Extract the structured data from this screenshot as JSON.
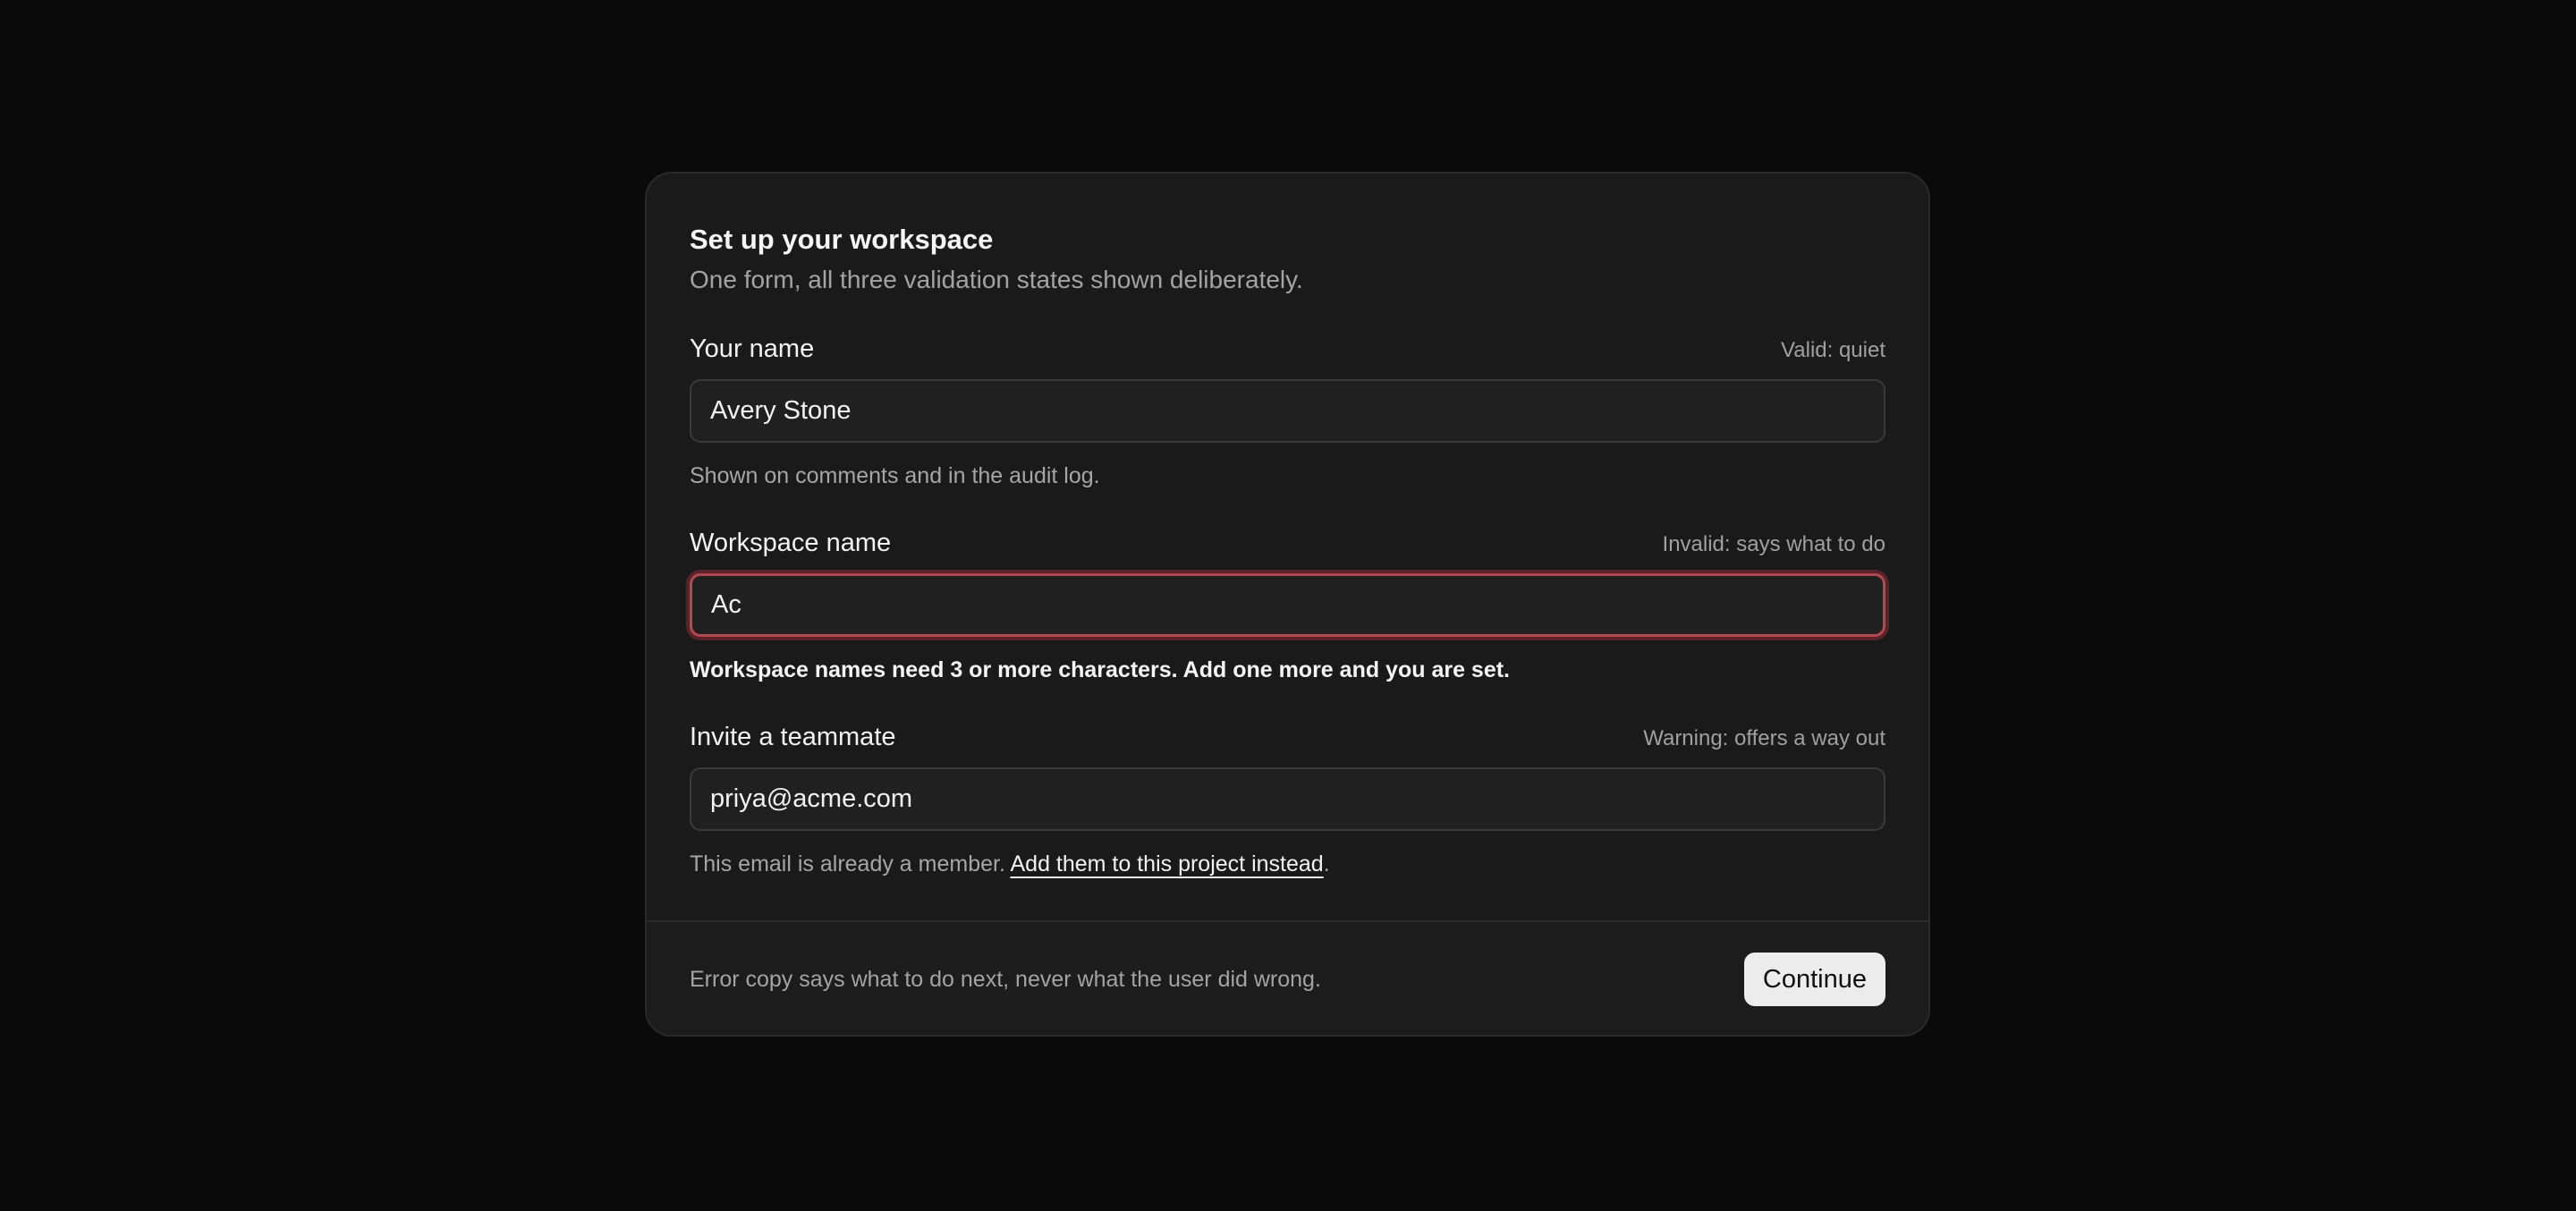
{
  "form": {
    "title": "Set up your workspace",
    "subtitle": "One form, all three validation states shown deliberately.",
    "fields": [
      {
        "label": "Your name",
        "state": "Valid: quiet",
        "value": "Avery Stone",
        "help": "Shown on comments and in the audit log."
      },
      {
        "label": "Workspace name",
        "state": "Invalid: says what to do",
        "value": "Ac",
        "help": "Workspace names need 3 or more characters. Add one more and you are set."
      },
      {
        "label": "Invite a teammate",
        "state": "Warning: offers a way out",
        "value": "priya@acme.com",
        "help_prefix": "This email is already a member. ",
        "help_link": "Add them to this project instead",
        "help_suffix": "."
      }
    ]
  },
  "footer": {
    "note": "Error copy says what to do next, never what the user did wrong.",
    "continue_label": "Continue"
  },
  "colors": {
    "page_background": "#0a0a0a",
    "card_background": "#1a1a1a",
    "error_border": "#b3494f",
    "button_background": "#ececec"
  }
}
